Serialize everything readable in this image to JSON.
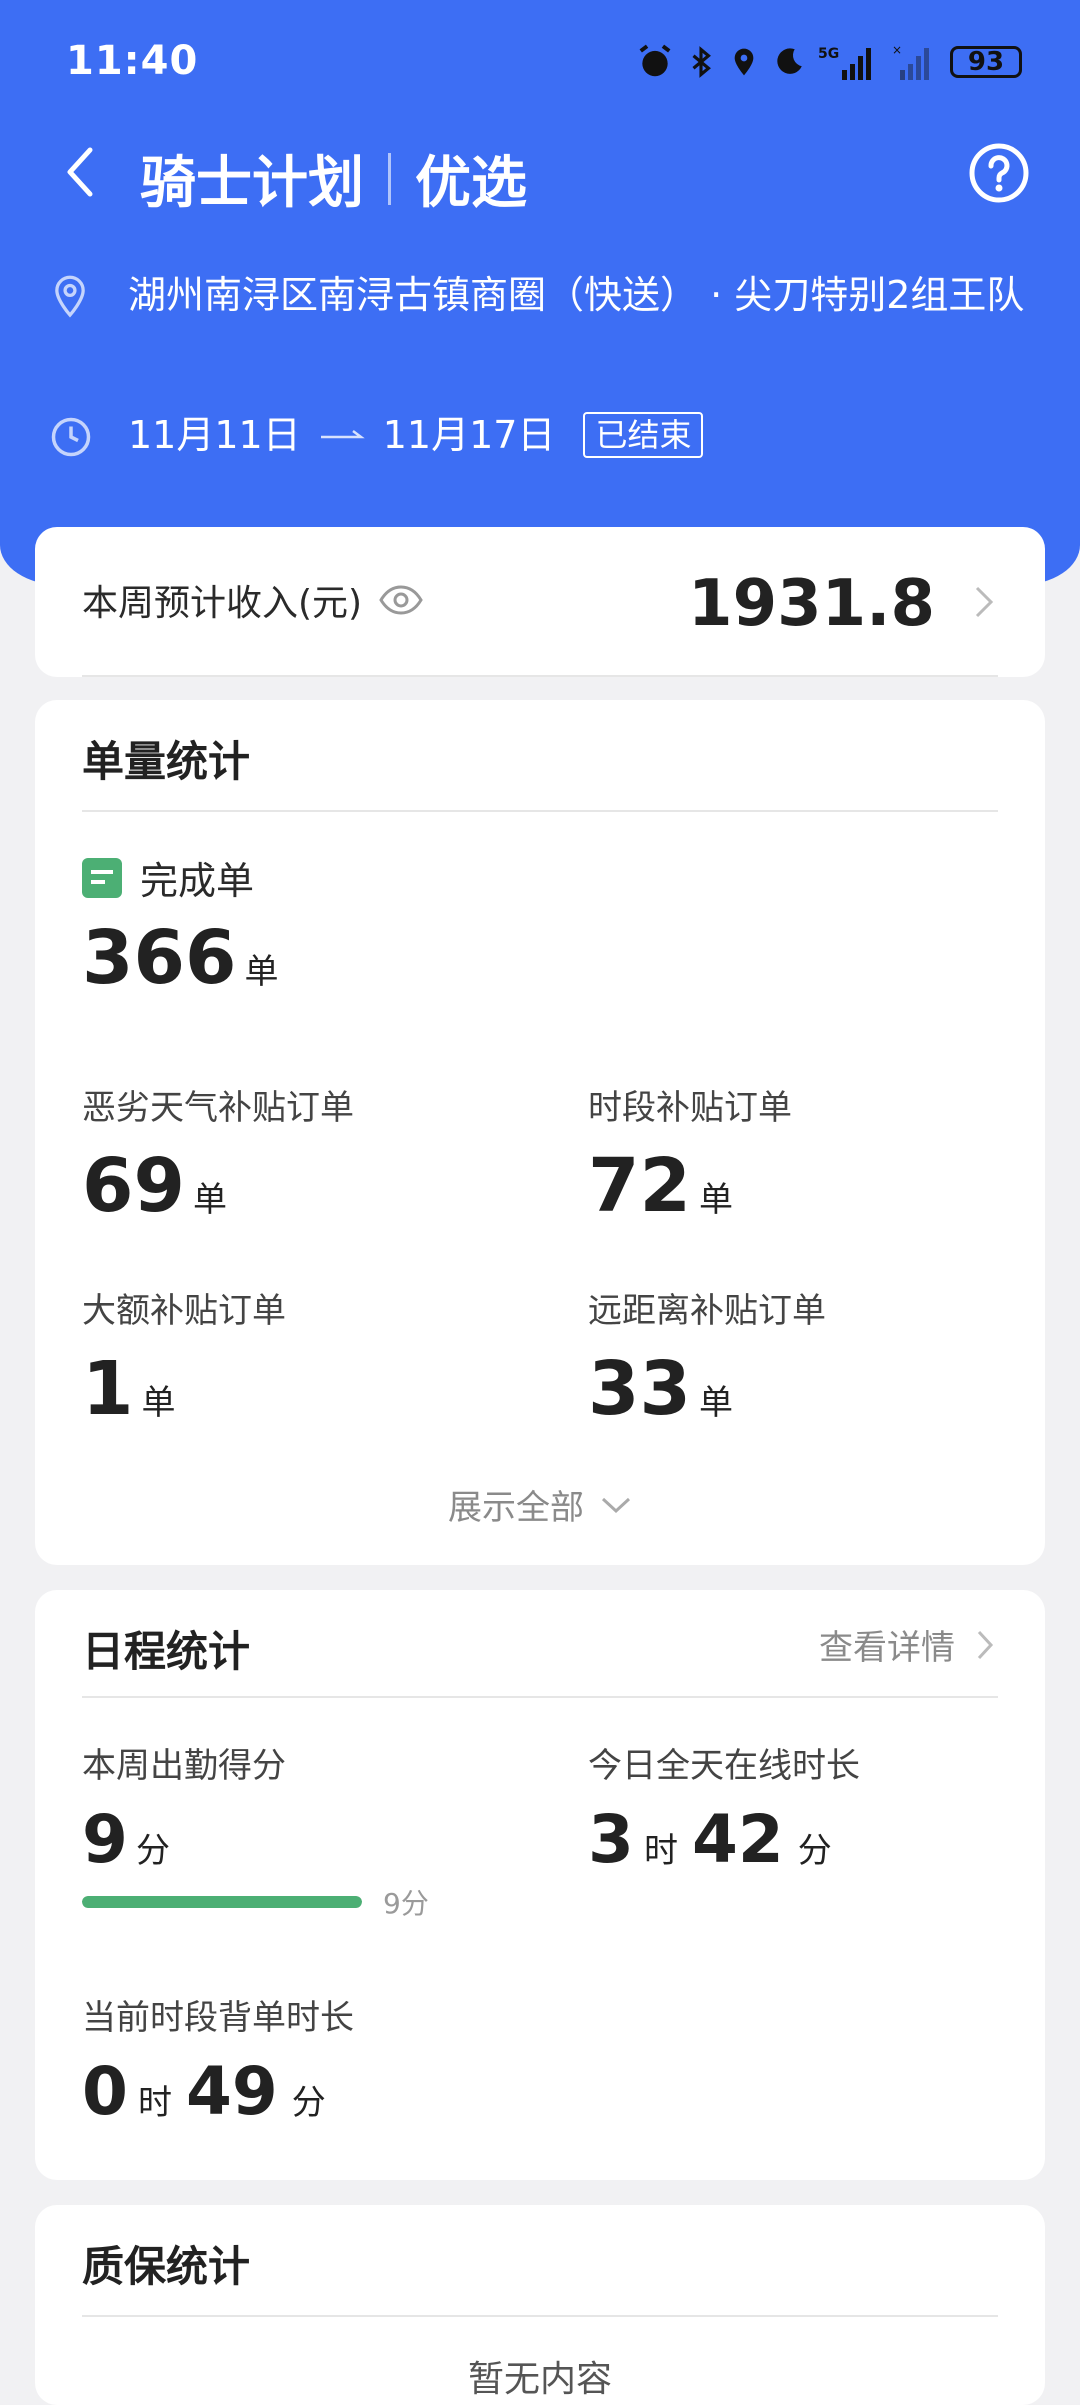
{
  "status_bar": {
    "time": "11:40",
    "battery": "93",
    "network": "5G"
  },
  "nav": {
    "title_main": "骑士计划",
    "title_sub": "优选"
  },
  "info": {
    "location": "湖州南浔区南浔古镇商圈（快送） · 尖刀特别2组王队",
    "date_start": "11月11日",
    "date_end": "11月17日",
    "status_badge": "已结束"
  },
  "income": {
    "label": "本周预计收入(元)",
    "value": "1931.8"
  },
  "orders": {
    "title": "单量统计",
    "completed_label": "完成单",
    "completed_value": "366",
    "unit": "单",
    "items": [
      {
        "label": "恶劣天气补贴订单",
        "value": "69"
      },
      {
        "label": "时段补贴订单",
        "value": "72"
      },
      {
        "label": "大额补贴订单",
        "value": "1"
      },
      {
        "label": "远距离补贴订单",
        "value": "33"
      }
    ],
    "show_all": "展示全部"
  },
  "schedule": {
    "title": "日程统计",
    "detail_link": "查看详情",
    "attendance_label": "本周出勤得分",
    "attendance_value": "9",
    "attendance_unit": "分",
    "attendance_progress": 1.0,
    "attendance_progress_label": "9分",
    "online_label": "今日全天在线时长",
    "online_hours": "3",
    "online_minutes": "42",
    "hour_unit": "时",
    "minute_unit": "分",
    "backlog_label": "当前时段背单时长",
    "backlog_hours": "0",
    "backlog_minutes": "49"
  },
  "quality": {
    "title": "质保统计",
    "partial_text": "暂无内容"
  },
  "colors": {
    "header_blue": "#3d6ef4",
    "progress_green": "#4caf74"
  }
}
